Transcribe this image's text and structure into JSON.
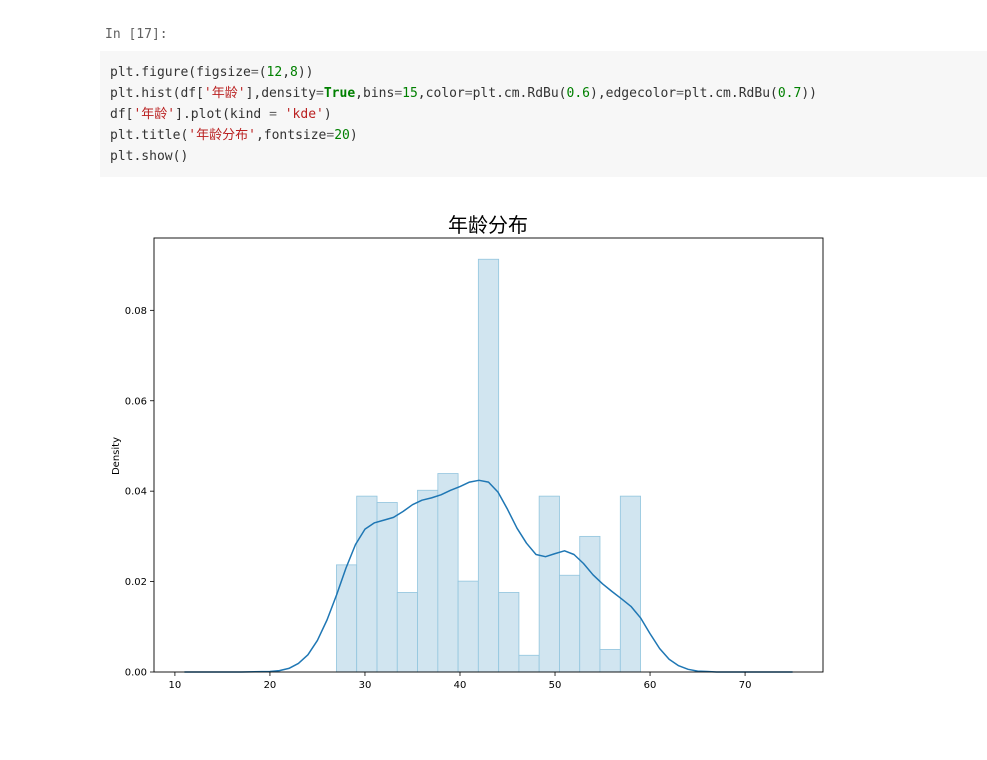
{
  "cell": {
    "prompt": "In [17]:",
    "code_lines": [
      "plt.figure(figsize=(12,8))",
      "plt.hist(df['年龄'],density=True,bins=15,color=plt.cm.RdBu(0.6),edgecolor=plt.cm.RdBu(0.7))",
      "df['年龄'].plot(kind = 'kde')",
      "plt.title('年龄分布',fontsize=20)",
      "plt.show()"
    ]
  },
  "colors": {
    "code_bg": "#f7f7f7",
    "prompt": "#616161",
    "string": "#ba2121",
    "keyword": "#008000",
    "bar_fill": "#d1e5f0",
    "bar_edge": "#92c5de",
    "kde_line": "#1f77b4"
  },
  "chart_data": {
    "type": "bar",
    "title": "年龄分布",
    "xlabel": "",
    "ylabel": "Density",
    "xlim": [
      7.8,
      78.2
    ],
    "ylim": [
      0,
      0.096
    ],
    "x_ticks": [
      10,
      20,
      30,
      40,
      50,
      60,
      70
    ],
    "y_ticks": [
      0.0,
      0.02,
      0.04,
      0.06,
      0.08
    ],
    "y_tick_labels": [
      "0.00",
      "0.02",
      "0.04",
      "0.06",
      "0.08"
    ],
    "grid": false,
    "legend": "none",
    "histogram": {
      "bin_edges": [
        27,
        29.13,
        31.27,
        33.4,
        35.53,
        37.67,
        39.8,
        41.93,
        44.07,
        46.2,
        48.33,
        50.47,
        52.6,
        54.73,
        56.87,
        59
      ],
      "densities": [
        0.0237,
        0.0389,
        0.0375,
        0.0176,
        0.0402,
        0.0439,
        0.0201,
        0.0913,
        0.0176,
        0.0037,
        0.0389,
        0.0214,
        0.03,
        0.005,
        0.0389
      ]
    },
    "kde": {
      "x": [
        11,
        14,
        17,
        20,
        21,
        22,
        23,
        24,
        25,
        26,
        27,
        28,
        29,
        30,
        31,
        32,
        33,
        34,
        35,
        36,
        37,
        38,
        39,
        40,
        41,
        42,
        43,
        44,
        45,
        46,
        47,
        48,
        49,
        50,
        51,
        52,
        53,
        54,
        55,
        56,
        57,
        58,
        59,
        60,
        61,
        62,
        63,
        64,
        65,
        66,
        67,
        68,
        70,
        72,
        75
      ],
      "y": [
        0.0,
        0.0,
        0.0,
        0.0001,
        0.0003,
        0.0008,
        0.0019,
        0.0038,
        0.007,
        0.0115,
        0.017,
        0.023,
        0.0282,
        0.0316,
        0.033,
        0.0336,
        0.0342,
        0.0355,
        0.037,
        0.038,
        0.0385,
        0.0392,
        0.0402,
        0.041,
        0.042,
        0.0424,
        0.042,
        0.0398,
        0.036,
        0.0318,
        0.0285,
        0.026,
        0.0255,
        0.0262,
        0.0268,
        0.026,
        0.024,
        0.0215,
        0.0195,
        0.0178,
        0.0162,
        0.0145,
        0.012,
        0.0085,
        0.0052,
        0.0028,
        0.0014,
        0.0006,
        0.0002,
        0.0001,
        0.0,
        0.0,
        0.0,
        0.0,
        0.0
      ]
    }
  }
}
